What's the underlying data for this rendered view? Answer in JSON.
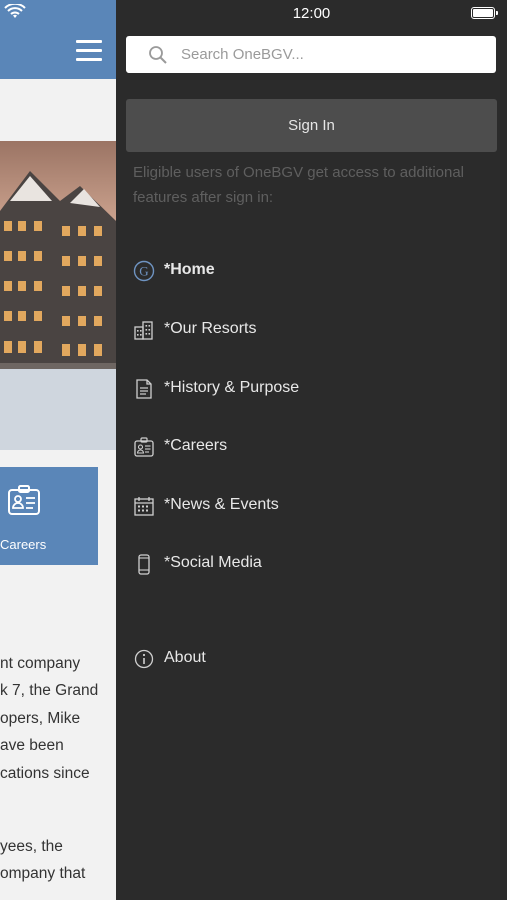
{
  "status_bar": {
    "time": "12:00"
  },
  "search": {
    "placeholder": "Search OneBGV..."
  },
  "sign_in": {
    "label": "Sign In"
  },
  "hint": "Eligible users of OneBGV get access to additional features after sign in:",
  "menu": {
    "items": [
      {
        "label": "*Home",
        "icon": "bgv-logo-icon"
      },
      {
        "label": "*Our Resorts",
        "icon": "buildings-icon"
      },
      {
        "label": "*History & Purpose",
        "icon": "document-icon"
      },
      {
        "label": "*Careers",
        "icon": "id-badge-icon"
      },
      {
        "label": "*News & Events",
        "icon": "calendar-icon"
      },
      {
        "label": "*Social Media",
        "icon": "phone-icon"
      }
    ],
    "about": {
      "label": "About",
      "icon": "info-icon"
    }
  },
  "background_page": {
    "tile_label": "Careers",
    "text_lines": [
      "nt company",
      "k 7, the Grand",
      "opers, Mike",
      "ave been",
      "cations since",
      "yees, the",
      "ompany that"
    ]
  },
  "colors": {
    "accent": "#5a86b8",
    "drawer": "#2b2b2b",
    "button": "#4d4d4d"
  }
}
